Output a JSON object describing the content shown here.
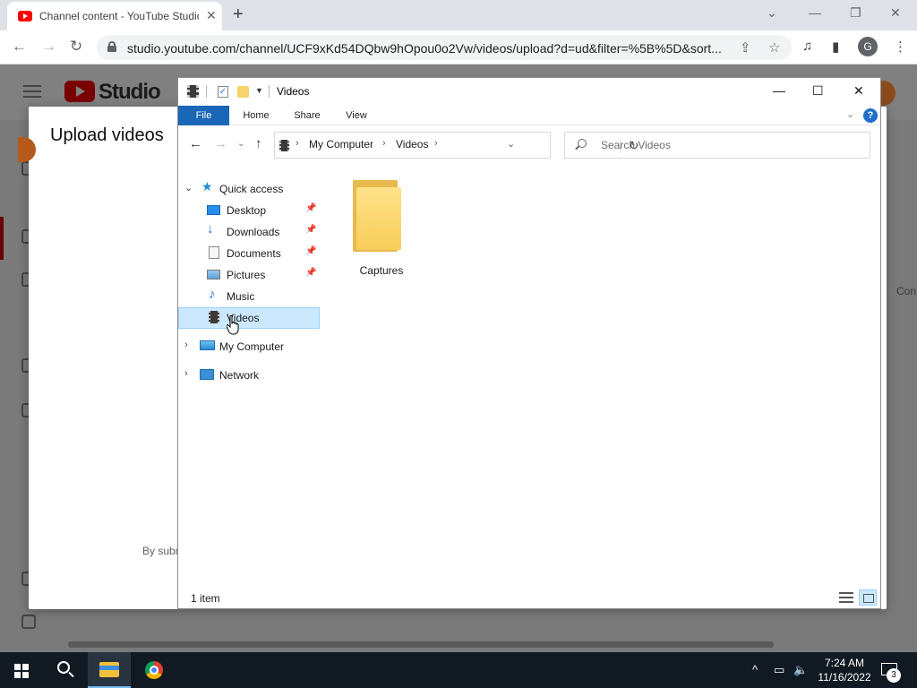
{
  "browser": {
    "tab_title": "Channel content - YouTube Studio",
    "url": "studio.youtube.com/channel/UCF9xKd54DQbw9hOpou0o2Vw/videos/upload?d=ud&filter=%5B%5D&sort...",
    "profile_initial": "G"
  },
  "studio": {
    "logo_text": "Studio",
    "peek_text": "Con"
  },
  "upload_modal": {
    "title": "Upload videos",
    "footer_text": "By submitting"
  },
  "explorer": {
    "title": "Videos",
    "ribbon_tabs": [
      "File",
      "Home",
      "Share",
      "View"
    ],
    "address": [
      "My Computer",
      "Videos"
    ],
    "search_placeholder": "Search Videos",
    "nav": {
      "quick_access": "Quick access",
      "items": [
        {
          "label": "Desktop",
          "pinned": true
        },
        {
          "label": "Downloads",
          "pinned": true
        },
        {
          "label": "Documents",
          "pinned": true
        },
        {
          "label": "Pictures",
          "pinned": true
        },
        {
          "label": "Music",
          "pinned": false
        },
        {
          "label": "Videos",
          "pinned": false,
          "selected": true
        }
      ],
      "my_computer": "My Computer",
      "network": "Network"
    },
    "folders": [
      {
        "label": "Captures"
      }
    ],
    "status": "1 item"
  },
  "taskbar": {
    "time": "7:24 AM",
    "date": "11/16/2022",
    "notification_count": "3"
  }
}
